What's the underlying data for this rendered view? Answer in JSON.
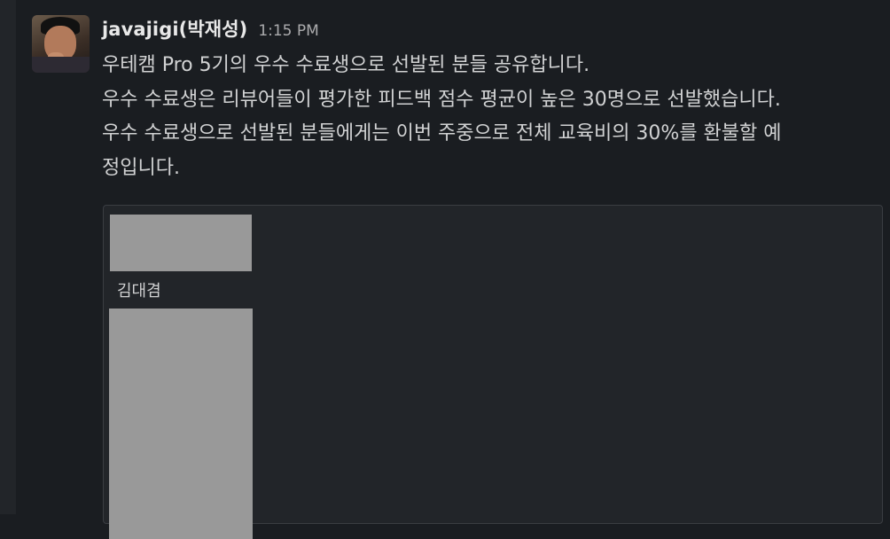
{
  "message": {
    "author": "javajigi(박재성)",
    "timestamp": "1:15 PM",
    "lines": [
      "우테캠 Pro 5기의 우수 수료생으로 선발된 분들 공유합니다.",
      "우수 수료생은 리뷰어들이 평가한 피드백 점수 평균이 높은 30명으로 선발했습니다.",
      "우수 수료생으로 선발된 분들에게는 이번 주중으로 전체 교육비의 30%를 환불할 예",
      "정입니다."
    ]
  },
  "attachment": {
    "caption": "김대겸"
  }
}
